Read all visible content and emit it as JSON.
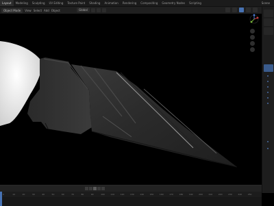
{
  "topbar": {
    "tabs": [
      "Layout",
      "Modeling",
      "Sculpting",
      "UV Editing",
      "Texture Paint",
      "Shading",
      "Animation",
      "Rendering",
      "Compositing",
      "Geometry Nodes",
      "Scripting"
    ],
    "active_tab_index": 0,
    "scene_label": "Scene"
  },
  "viewport_header": {
    "mode": "Object Mode",
    "menus": [
      "View",
      "Select",
      "Add",
      "Object"
    ],
    "orientation_label": "Global"
  },
  "timeline": {
    "frame_marks": [
      "0",
      "10",
      "20",
      "30",
      "40",
      "50",
      "60",
      "70",
      "80",
      "90",
      "100",
      "110",
      "120",
      "130",
      "140",
      "150",
      "160",
      "170",
      "180",
      "190",
      "200",
      "210",
      "220",
      "230",
      "240",
      "250"
    ],
    "current_frame_fraction": 0.0
  },
  "colors": {
    "accent": "#4772b3",
    "viewport_bg": "#000000"
  },
  "icons": {
    "gizmo": "navigation-gizmo-icon",
    "zoom": "zoom-icon",
    "hand": "pan-hand-icon",
    "camera": "camera-icon",
    "grid": "grid-icon"
  }
}
